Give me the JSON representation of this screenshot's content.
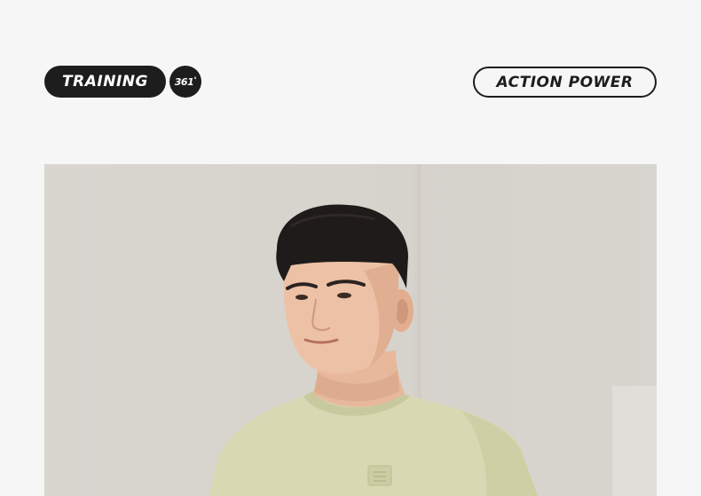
{
  "header": {
    "badge_text": "TRAINING",
    "logo_text": "361",
    "logo_degree": "°",
    "tagline": "ACTION POWER"
  },
  "photo": {
    "subject": "male model in light green crew-neck t-shirt"
  }
}
